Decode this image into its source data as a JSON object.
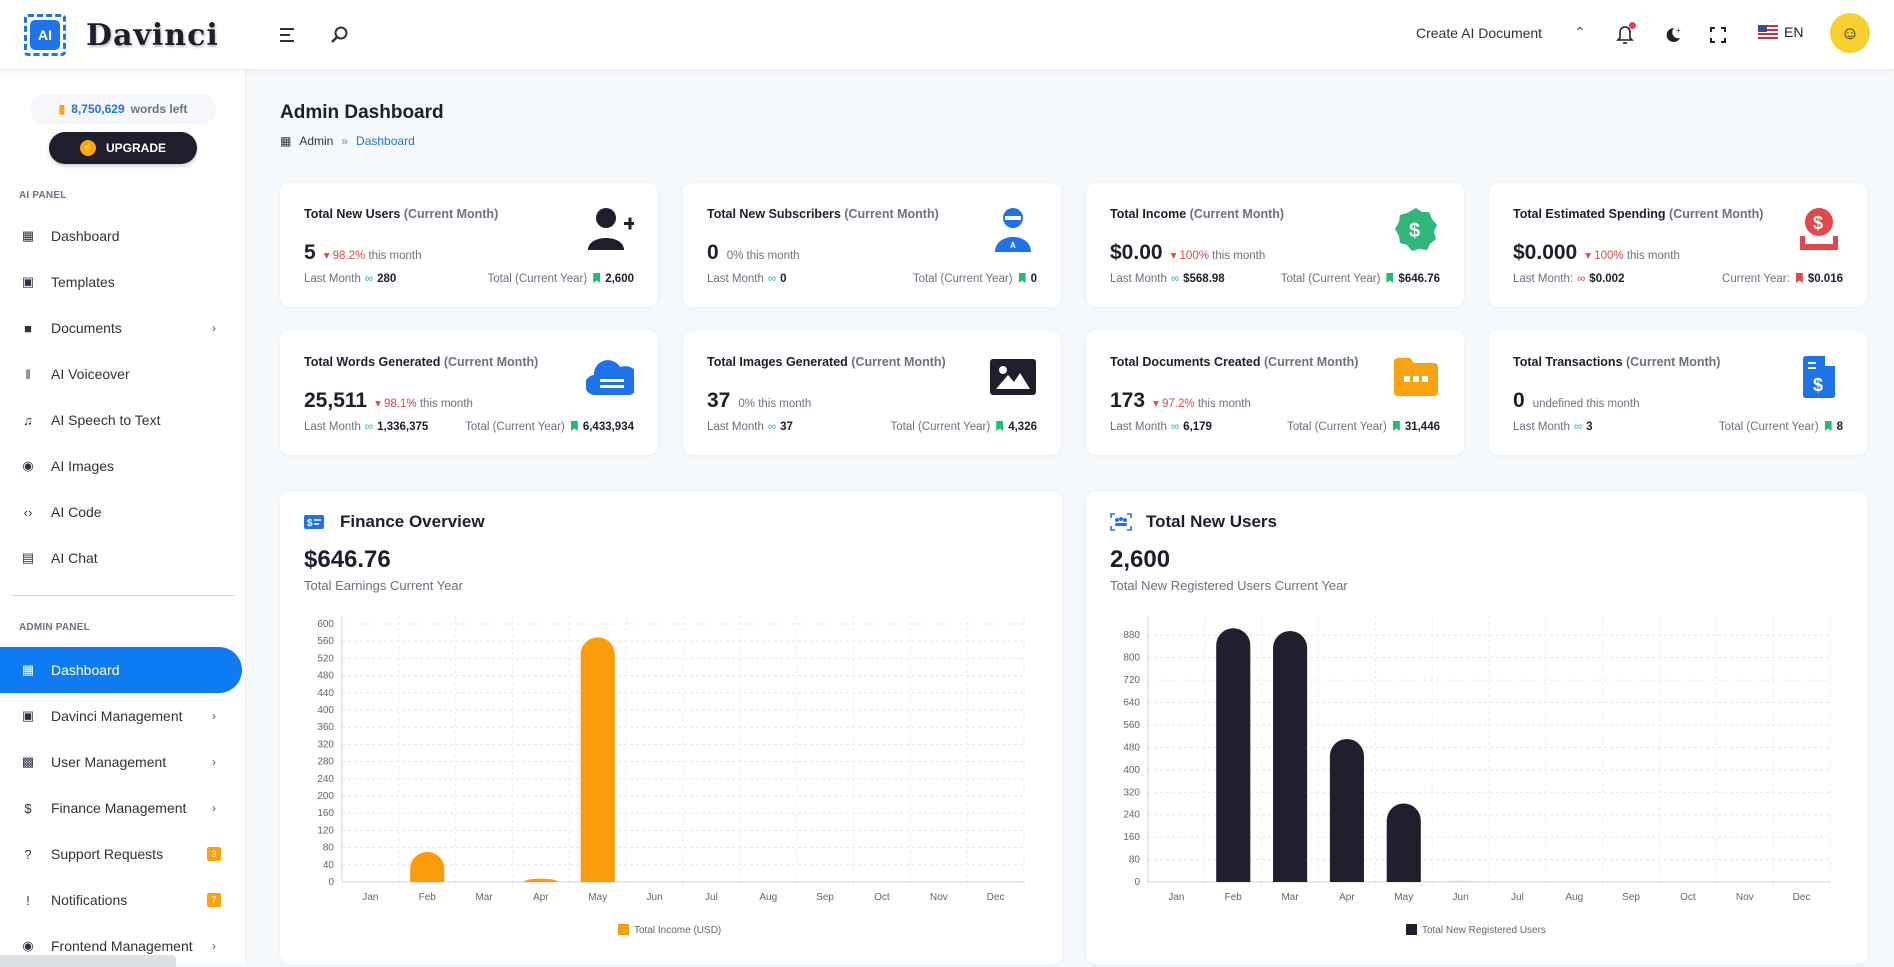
{
  "app": {
    "brand": "Davinci",
    "logo_chip": "AI"
  },
  "topbar": {
    "create_doc": "Create AI Document",
    "language": "EN",
    "icons": [
      "menu-icon",
      "search-icon",
      "caret-up-icon",
      "bell-icon",
      "moon-icon",
      "fullscreen-icon"
    ]
  },
  "sidebar": {
    "words_count": "8,750,629",
    "words_label": "words left",
    "upgrade": "UPGRADE",
    "ai_panel_label": "AI PANEL",
    "ai_items": [
      {
        "label": "Dashboard",
        "icon": "dashboard-icon",
        "chevron": false
      },
      {
        "label": "Templates",
        "icon": "ai-chip-icon",
        "chevron": false
      },
      {
        "label": "Documents",
        "icon": "folder-icon",
        "chevron": true
      },
      {
        "label": "AI Voiceover",
        "icon": "waveform-icon",
        "chevron": false
      },
      {
        "label": "AI Speech to Text",
        "icon": "music-folder-icon",
        "chevron": false
      },
      {
        "label": "AI Images",
        "icon": "camera-frame-icon",
        "chevron": false
      },
      {
        "label": "AI Code",
        "icon": "code-icon",
        "chevron": false
      },
      {
        "label": "AI Chat",
        "icon": "chat-icon",
        "chevron": false
      }
    ],
    "admin_panel_label": "ADMIN PANEL",
    "admin_items": [
      {
        "label": "Dashboard",
        "icon": "dashboard-icon",
        "active": true
      },
      {
        "label": "Davinci Management",
        "icon": "ai-chip-icon",
        "chevron": true
      },
      {
        "label": "User Management",
        "icon": "user-badge-icon",
        "chevron": true
      },
      {
        "label": "Finance Management",
        "icon": "money-bag-icon",
        "chevron": true
      },
      {
        "label": "Support Requests",
        "icon": "question-chat-icon",
        "badge": "3"
      },
      {
        "label": "Notifications",
        "icon": "alert-chat-icon",
        "badge": "7"
      },
      {
        "label": "Frontend Management",
        "icon": "globe-icon",
        "chevron": true
      }
    ]
  },
  "page": {
    "title": "Admin Dashboard",
    "breadcrumb": {
      "root": "Admin",
      "sep": "»",
      "current": "Dashboard"
    }
  },
  "stats": [
    {
      "title": "Total New Users",
      "period": "(Current Month)",
      "value": "5",
      "change": "98.2%",
      "change_dir": "down",
      "change_suffix": "this month",
      "last_label": "Last Month",
      "last_value": "280",
      "total_label": "Total (Current Year)",
      "total_value": "2,600",
      "icon": "user-plus-icon"
    },
    {
      "title": "Total New Subscribers",
      "period": "(Current Month)",
      "value": "0",
      "change": "0%",
      "change_dir": "none",
      "change_suffix": "this month",
      "last_label": "Last Month",
      "last_value": "0",
      "total_label": "Total (Current Year)",
      "total_value": "0",
      "icon": "subscriber-icon"
    },
    {
      "title": "Total Income",
      "period": "(Current Month)",
      "value": "$0.00",
      "change": "100%",
      "change_dir": "down",
      "change_suffix": "this month",
      "last_label": "Last Month",
      "last_value": "$568.98",
      "total_label": "Total (Current Year)",
      "total_value": "$646.76",
      "icon": "dollar-badge-icon"
    },
    {
      "title": "Total Estimated Spending",
      "period": "(Current Month)",
      "value": "$0.000",
      "change": "100%",
      "change_dir": "down",
      "change_suffix": "this month",
      "last_label": "Last Month:",
      "last_value": "$0.002",
      "total_label": "Current Year:",
      "total_value": "$0.016",
      "icon": "dollar-tray-icon",
      "red": true
    },
    {
      "title": "Total Words Generated",
      "period": "(Current Month)",
      "value": "25,511",
      "change": "98.1%",
      "change_dir": "down",
      "change_suffix": "this month",
      "last_label": "Last Month",
      "last_value": "1,336,375",
      "total_label": "Total (Current Year)",
      "total_value": "6,433,934",
      "icon": "cloud-icon"
    },
    {
      "title": "Total Images Generated",
      "period": "(Current Month)",
      "value": "37",
      "change": "0%",
      "change_dir": "none",
      "change_suffix": "this month",
      "last_label": "Last Month",
      "last_value": "37",
      "total_label": "Total (Current Year)",
      "total_value": "4,326",
      "icon": "image-icon"
    },
    {
      "title": "Total Documents Created",
      "period": "(Current Month)",
      "value": "173",
      "change": "97.2%",
      "change_dir": "down",
      "change_suffix": "this month",
      "last_label": "Last Month",
      "last_value": "6,179",
      "total_label": "Total (Current Year)",
      "total_value": "31,446",
      "icon": "folder-dots-icon"
    },
    {
      "title": "Total Transactions",
      "period": "(Current Month)",
      "value": "0",
      "change": "undefined",
      "change_dir": "none",
      "change_suffix": "this month",
      "last_label": "Last Month",
      "last_value": "3",
      "total_label": "Total (Current Year)",
      "total_value": "8",
      "icon": "invoice-icon"
    }
  ],
  "finance": {
    "title": "Finance Overview",
    "value": "$646.76",
    "subtitle": "Total Earnings Current Year"
  },
  "users": {
    "title": "Total New Users",
    "value": "2,600",
    "subtitle": "Total New Registered Users Current Year"
  },
  "colors": {
    "accent": "#0d7cf2",
    "income": "#fa9c0a",
    "users": "#1f1f2e",
    "danger": "#e2474b",
    "success": "#1ebd6f"
  },
  "chart_data": [
    {
      "type": "bar",
      "title": "Finance Overview",
      "categories": [
        "Jan",
        "Feb",
        "Mar",
        "Apr",
        "May",
        "Jun",
        "Jul",
        "Aug",
        "Sep",
        "Oct",
        "Nov",
        "Dec"
      ],
      "series": [
        {
          "name": "Total Income (USD)",
          "values": [
            0,
            70,
            0,
            7.78,
            568.98,
            0,
            0,
            0,
            0,
            0,
            0,
            0
          ]
        }
      ],
      "yticks": [
        0,
        40,
        80,
        120,
        160,
        200,
        240,
        280,
        320,
        360,
        400,
        440,
        480,
        520,
        560,
        600
      ],
      "ylim": [
        0,
        600
      ],
      "grid": true,
      "legend": "bottom"
    },
    {
      "type": "bar",
      "title": "Total New Users",
      "categories": [
        "Jan",
        "Feb",
        "Mar",
        "Apr",
        "May",
        "Jun",
        "Jul",
        "Aug",
        "Sep",
        "Oct",
        "Nov",
        "Dec"
      ],
      "series": [
        {
          "name": "Total New Registered Users",
          "values": [
            0,
            905,
            895,
            510,
            280,
            5,
            0,
            0,
            0,
            0,
            0,
            0
          ]
        }
      ],
      "yticks": [
        0,
        80,
        160,
        240,
        320,
        400,
        480,
        560,
        640,
        720,
        800,
        880
      ],
      "ylim": [
        0,
        920
      ],
      "grid": true,
      "legend": "bottom"
    }
  ]
}
